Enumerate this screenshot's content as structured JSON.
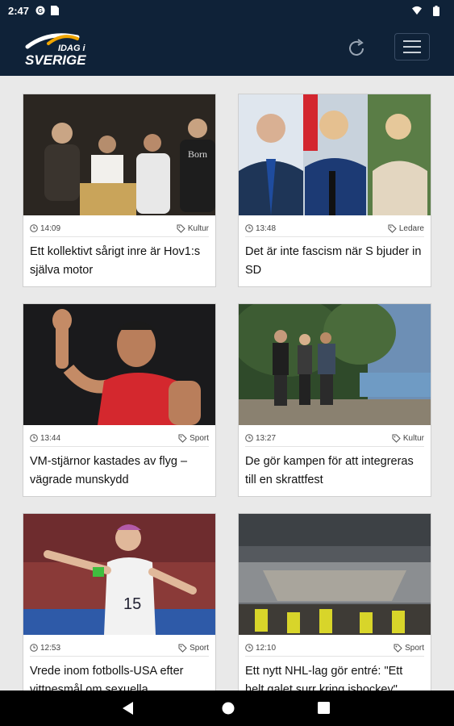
{
  "status_bar": {
    "time": "2:47",
    "icons": [
      "notification-g-icon",
      "notification-doc-icon",
      "wifi-icon",
      "battery-icon"
    ]
  },
  "app_bar": {
    "logo_top": "IDAG i",
    "logo_bottom": "SVERIGE",
    "refresh_icon": "refresh-icon",
    "menu_icon": "hamburger-menu-icon"
  },
  "articles": [
    {
      "time": "14:09",
      "category": "Kultur",
      "title": "Ett kollektivt sårigt inre är Hov1:s själva motor"
    },
    {
      "time": "13:48",
      "category": "Ledare",
      "title": "Det är inte fascism när S bjuder in SD"
    },
    {
      "time": "13:44",
      "category": "Sport",
      "title": "VM-stjärnor kastades av flyg – vägrade munskydd"
    },
    {
      "time": "13:27",
      "category": "Kultur",
      "title": "De gör kampen för att integreras till en skrattfest"
    },
    {
      "time": "12:53",
      "category": "Sport",
      "title": "Vrede inom fotbolls-USA efter vittnesmål om sexuella"
    },
    {
      "time": "12:10",
      "category": "Sport",
      "title": "Ett nytt NHL-lag gör entré: \"Ett helt galet surr kring ishockey\""
    }
  ],
  "colors": {
    "header_bg": "#0f2238",
    "page_bg": "#e9e9e9",
    "card_bg": "#ffffff",
    "logo_accent": "#f0a500"
  },
  "nav_bar": {
    "icons": [
      "back-icon",
      "home-icon",
      "recents-icon"
    ]
  }
}
